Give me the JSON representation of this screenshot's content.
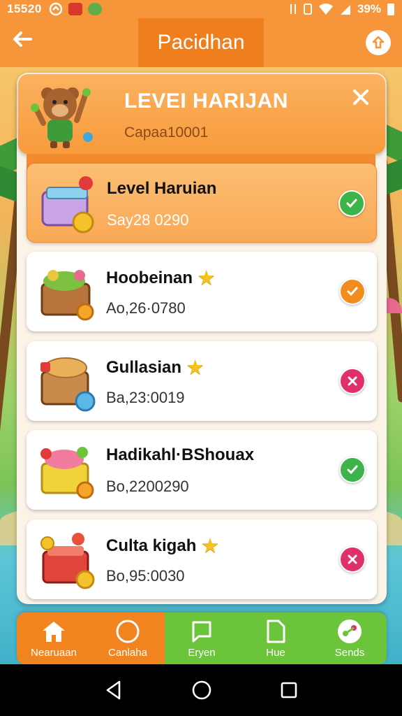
{
  "status_bar": {
    "time": "15520",
    "battery": "39%"
  },
  "app_bar": {
    "back_icon": "arrow-left-icon",
    "title": "Pacidhan",
    "action_icon": "upload-icon"
  },
  "header": {
    "title": "LEVEI HARIJAN",
    "subtitle": "Caрaa10001",
    "close_icon": "close-icon"
  },
  "levels": [
    {
      "name": "Level Haruian",
      "code": "Saу28 0290",
      "star": false,
      "status": "check",
      "status_color": "#3db44a",
      "active": true
    },
    {
      "name": "Hoobeinan",
      "code": "Ao,26·0780",
      "star": true,
      "status": "check",
      "status_color": "#f28c1e",
      "active": false
    },
    {
      "name": "Gullasian",
      "code": "Ba,23:0019",
      "star": true,
      "status": "cross",
      "status_color": "#e0306a",
      "active": false
    },
    {
      "name": "Hadikahl·BShouax",
      "code": "Bo,2200290",
      "star": false,
      "status": "check",
      "status_color": "#3db44a",
      "active": false
    },
    {
      "name": "Culta kigah",
      "code": "Bo,95:0030",
      "star": true,
      "status": "cross",
      "status_color": "#e0306a",
      "active": false
    }
  ],
  "bottom_nav": [
    {
      "label": "Nearuaan",
      "icon": "home-icon",
      "bg": "#f2841f"
    },
    {
      "label": "Canlaha",
      "icon": "circle-icon",
      "bg": "#f2841f"
    },
    {
      "label": "Eryen",
      "icon": "chat-icon",
      "bg": "#6cc43a"
    },
    {
      "label": "Hue",
      "icon": "document-icon",
      "bg": "#6cc43a"
    },
    {
      "label": "Sends",
      "icon": "share-icon",
      "bg": "#6cc43a"
    }
  ],
  "colors": {
    "accent_orange": "#f6953a",
    "dark_orange": "#ef7f1e",
    "green": "#6cc43a"
  }
}
